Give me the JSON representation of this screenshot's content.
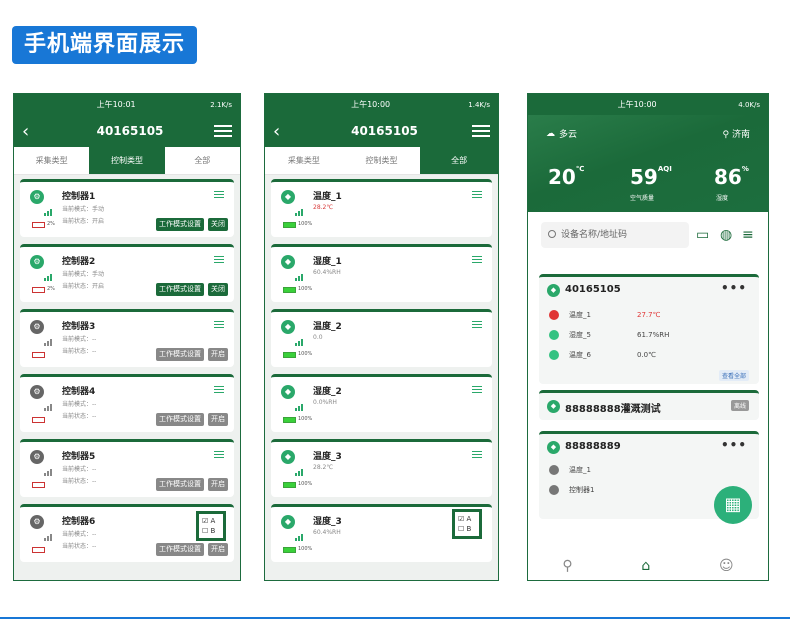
{
  "title": "手机端界面展示",
  "phone1": {
    "status_left": "上午10:01",
    "status_right": "2.1K/s",
    "header_title": "40165105",
    "tabs": [
      "采集类型",
      "控制类型",
      "全部"
    ],
    "mode_label": "当前模式：",
    "state_label": "当前状态：",
    "mode_btn": "工作模式设置",
    "devices": [
      {
        "name": "控制器1",
        "mode": "手动",
        "state": "开启",
        "battery": "2%",
        "action": "关闭",
        "online": true
      },
      {
        "name": "控制器2",
        "mode": "手动",
        "state": "开启",
        "battery": "2%",
        "action": "关闭",
        "online": true
      },
      {
        "name": "控制器3",
        "mode": "--",
        "state": "--",
        "battery": "",
        "action": "开启",
        "online": false
      },
      {
        "name": "控制器4",
        "mode": "--",
        "state": "--",
        "battery": "",
        "action": "开启",
        "online": false
      },
      {
        "name": "控制器5",
        "mode": "--",
        "state": "--",
        "battery": "",
        "action": "开启",
        "online": false
      },
      {
        "name": "控制器6",
        "mode": "--",
        "state": "--",
        "battery": "",
        "action": "开启",
        "online": false
      }
    ],
    "checkbox_a": "A",
    "checkbox_b": "B"
  },
  "phone2": {
    "status_left": "上午10:00",
    "status_right": "1.4K/s",
    "header_title": "40165105",
    "tabs": [
      "采集类型",
      "控制类型",
      "全部"
    ],
    "sensors": [
      {
        "name": "温度_1",
        "value": "28.2℃",
        "alert": true,
        "battery": "100%"
      },
      {
        "name": "湿度_1",
        "value": "60.4%RH",
        "alert": false,
        "battery": "100%"
      },
      {
        "name": "温度_2",
        "value": "0.0",
        "alert": false,
        "battery": "100%"
      },
      {
        "name": "湿度_2",
        "value": "0.0%RH",
        "alert": false,
        "battery": "100%"
      },
      {
        "name": "温度_3",
        "value": "28.2℃",
        "alert": false,
        "battery": "100%"
      },
      {
        "name": "湿度_3",
        "value": "60.4%RH",
        "alert": false,
        "battery": "100%"
      }
    ],
    "checkbox_a": "A",
    "checkbox_b": "B"
  },
  "phone3": {
    "status_left": "上午10:00",
    "status_right": "4.0K/s",
    "weather": "多云",
    "city": "济南",
    "temp": "20",
    "temp_unit": "℃",
    "aqi": "59",
    "aqi_unit": "AQI",
    "aqi_label": "空气质量",
    "humidity": "86",
    "humidity_unit": "%",
    "humidity_label": "湿度",
    "search_placeholder": "设备名称/地址码",
    "groups": [
      {
        "title": "40165105",
        "rows": [
          {
            "name": "温度_1",
            "value": "27.7℃",
            "color": "#e03535"
          },
          {
            "name": "湿度_5",
            "value": "61.7%RH",
            "color": "#34c282"
          },
          {
            "name": "温度_6",
            "value": "0.0℃",
            "color": "#34c282"
          }
        ],
        "tag": "查看全部"
      },
      {
        "title": "88888888灌溉测试",
        "tag": "离线"
      },
      {
        "title": "88888889",
        "rows": [
          {
            "name": "温度_1",
            "color": "#777777"
          },
          {
            "name": "控制器1",
            "color": "#777777"
          }
        ]
      }
    ]
  }
}
